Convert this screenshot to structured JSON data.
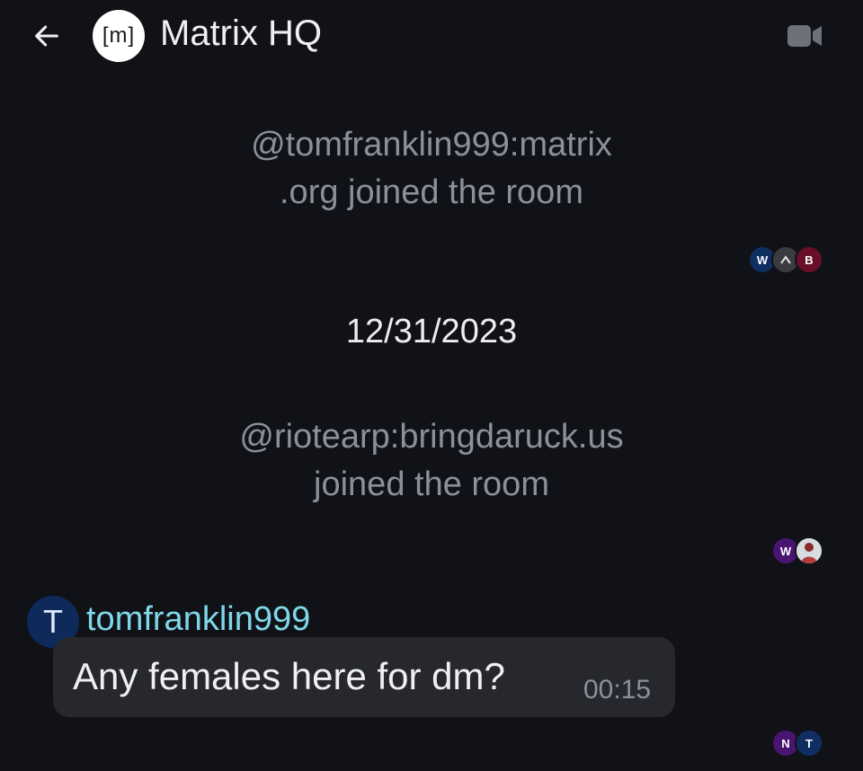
{
  "header": {
    "room_name": "Matrix HQ",
    "room_avatar_text": "[m]",
    "back_icon": "arrow-left-icon",
    "video_icon": "video-call-icon"
  },
  "timeline": {
    "event1": {
      "line1": "@tomfranklin999:matrix",
      "line2": ".org joined the room"
    },
    "receipts1": [
      "W",
      "A",
      "B"
    ],
    "date_separator": "12/31/2023",
    "event2": {
      "line1": "@riotearp:bringdaruck.us",
      "line2": "joined the room"
    },
    "receipts2": [
      "W"
    ],
    "message": {
      "avatar_letter": "T",
      "sender": "tomfranklin999",
      "body": "Any females here for dm?",
      "time": "00:15"
    },
    "receipts3": [
      "N",
      "T"
    ]
  },
  "colors": {
    "background": "#101217",
    "sender_name": "#7fd7e8",
    "bubble": "#26282d",
    "muted_text": "#8b9199"
  }
}
